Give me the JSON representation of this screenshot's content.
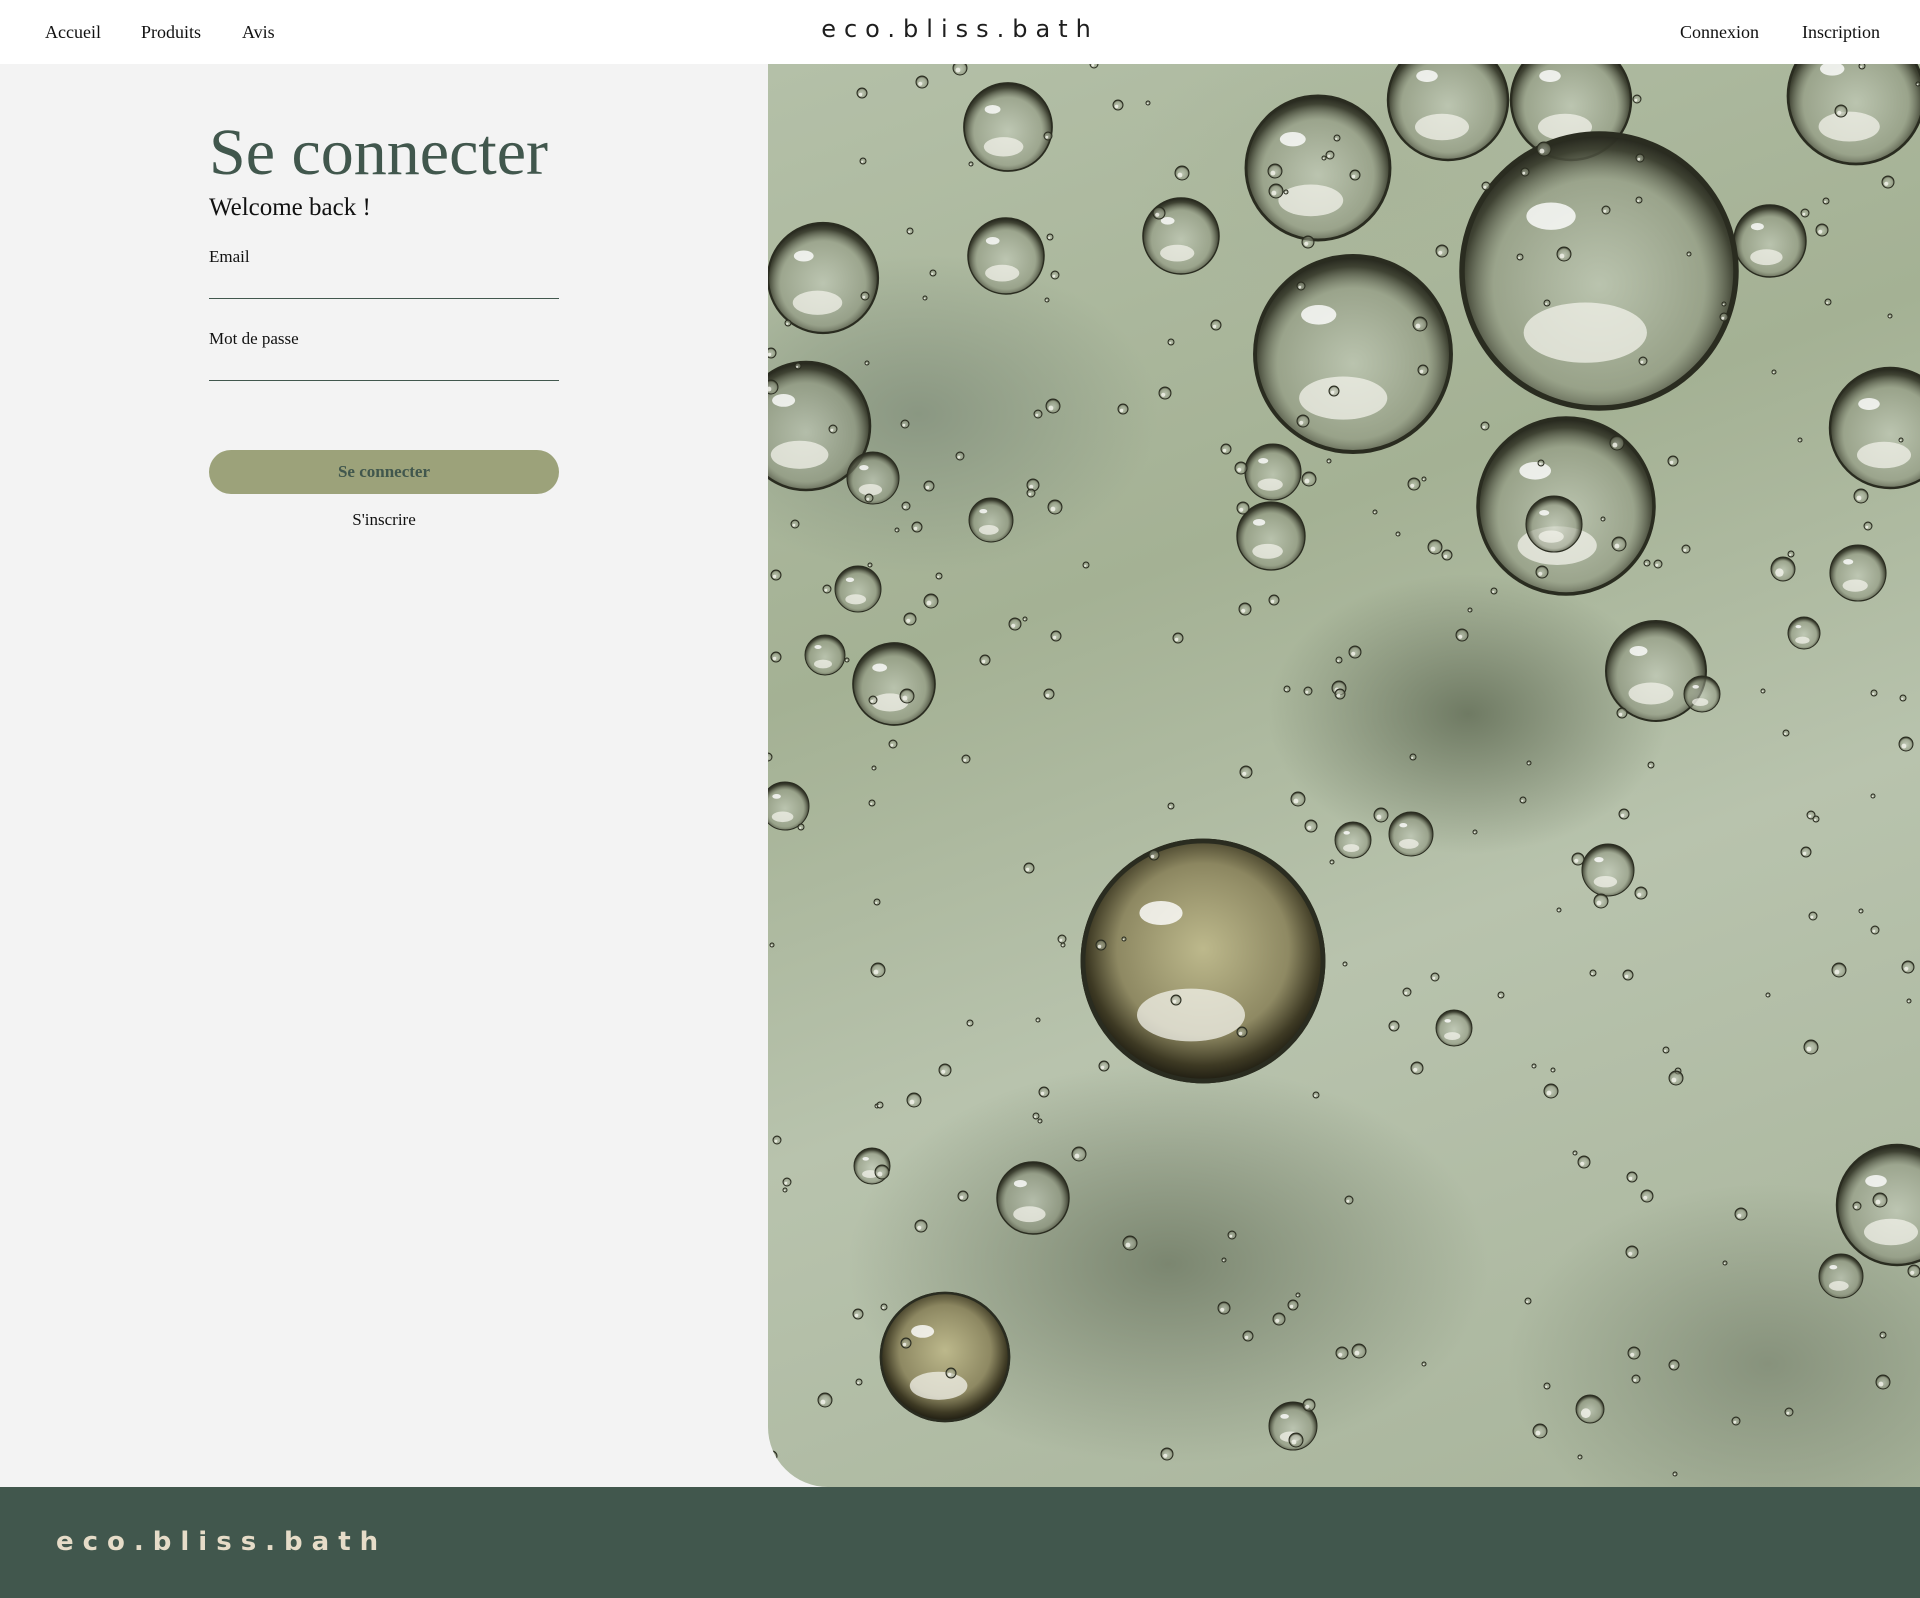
{
  "header": {
    "nav": {
      "home": "Accueil",
      "products": "Produits",
      "reviews": "Avis"
    },
    "brand": "eco.bliss.bath",
    "auth": {
      "login": "Connexion",
      "register": "Inscription"
    }
  },
  "login_form": {
    "title": "Se connecter",
    "subtitle": "Welcome back !",
    "email_label": "Email",
    "email_value": "",
    "password_label": "Mot de passe",
    "password_value": "",
    "submit_label": "Se connecter",
    "signup_link": "S'inscrire"
  },
  "hero": {
    "image": "bubbles-in-green-water",
    "colors": {
      "base": "#a9b59a",
      "bubble_rim": "#3a3d2e",
      "bubble_highlight": "#f2f2ea"
    }
  },
  "footer": {
    "brand": "eco.bliss.bath"
  },
  "colors": {
    "primary": "#41574d",
    "accent": "#9ca27a",
    "background": "#f3f3f3",
    "footer_text": "#e6dcc8"
  }
}
